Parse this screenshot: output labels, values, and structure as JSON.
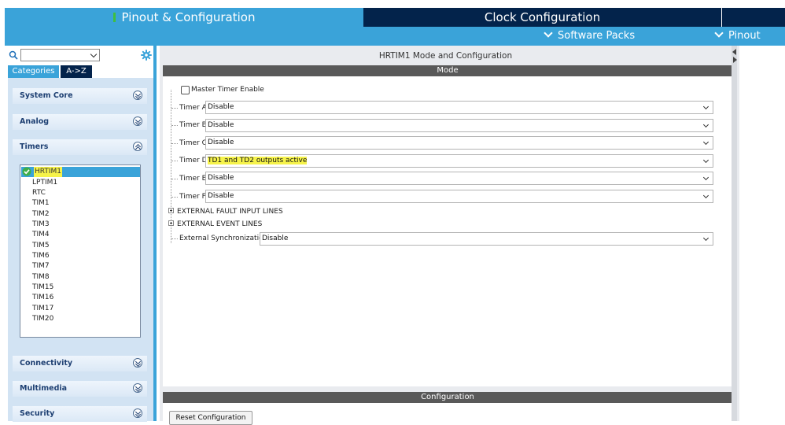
{
  "header": {
    "tabs": [
      "Pinout & Configuration",
      "Clock Configuration"
    ],
    "submenu": [
      "Software Packs",
      "Pinout"
    ]
  },
  "sidebar": {
    "search": {
      "value": ""
    },
    "view_tabs": [
      "Categories",
      "A->Z"
    ],
    "categories": [
      "System Core",
      "Analog",
      "Timers",
      "Connectivity",
      "Multimedia",
      "Security"
    ],
    "timers": {
      "selected": "HRTIM1",
      "items": [
        "LPTIM1",
        "RTC",
        "TIM1",
        "TIM2",
        "TIM3",
        "TIM4",
        "TIM5",
        "TIM6",
        "TIM7",
        "TIM8",
        "TIM15",
        "TIM16",
        "TIM17",
        "TIM20"
      ]
    }
  },
  "main": {
    "title": "HRTIM1 Mode and Configuration",
    "mode_header": "Mode",
    "master_timer_label": "Master Timer Enable",
    "timers": [
      {
        "label": "Timer A",
        "value": "Disable"
      },
      {
        "label": "Timer B",
        "value": "Disable"
      },
      {
        "label": "Timer C",
        "value": "Disable"
      },
      {
        "label": "Timer D",
        "value": "TD1 and TD2 outputs active"
      },
      {
        "label": "Timer E",
        "value": "Disable"
      },
      {
        "label": "Timer F",
        "value": "Disable"
      }
    ],
    "tree_groups": [
      "EXTERNAL FAULT INPUT LINES",
      "EXTERNAL EVENT LINES"
    ],
    "ext_sync": {
      "label": "External Synchronization",
      "value": "Disable"
    },
    "config_header": "Configuration",
    "reset_button": "Reset Configuration"
  },
  "colors": {
    "accent": "#3aa3d9",
    "dark": "#03234b",
    "highlight": "#f6f34a"
  }
}
